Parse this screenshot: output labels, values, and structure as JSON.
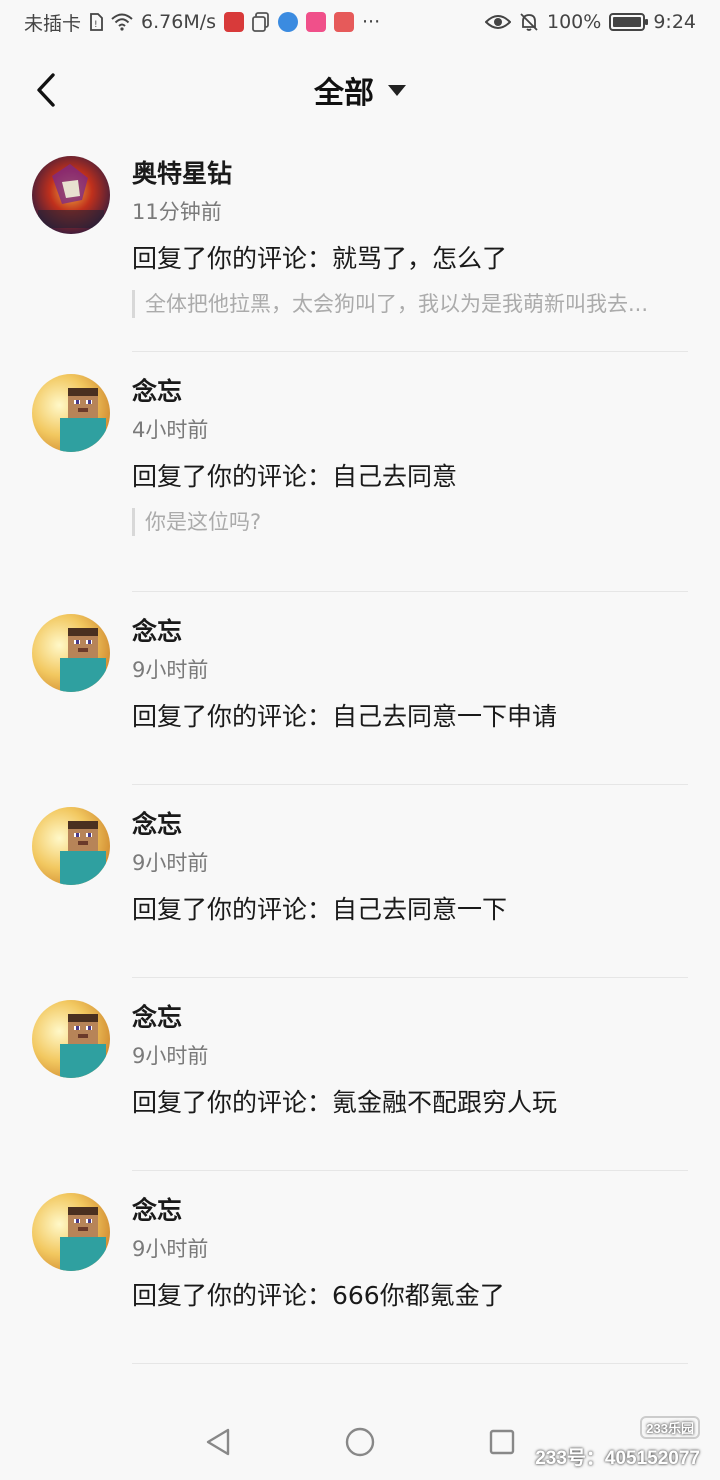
{
  "status_bar": {
    "carrier": "未插卡",
    "speed": "6.76M/s",
    "more": "···",
    "battery": "100%",
    "time": "9:24",
    "app_badge_colors": [
      "#d83a3a",
      "#3b8be0",
      "#f0508a",
      "#e65a5a"
    ]
  },
  "header": {
    "title": "全部"
  },
  "notifications": [
    {
      "name": "奥特星钻",
      "time": "11分钟前",
      "reply": "回复了你的评论：就骂了，怎么了",
      "quote": "全体把他拉黑，太会狗叫了，我以为是我萌新叫我去..."
    },
    {
      "name": "念忘",
      "time": "4小时前",
      "reply": "回复了你的评论：自己去同意",
      "quote": "你是这位吗?"
    },
    {
      "name": "念忘",
      "time": "9小时前",
      "reply": "回复了你的评论：自己去同意一下申请"
    },
    {
      "name": "念忘",
      "time": "9小时前",
      "reply": "回复了你的评论：自己去同意一下"
    },
    {
      "name": "念忘",
      "time": "9小时前",
      "reply": "回复了你的评论：氪金融不配跟穷人玩"
    },
    {
      "name": "念忘",
      "time": "9小时前",
      "reply": "回复了你的评论：666你都氪金了"
    }
  ],
  "watermark": {
    "logo": "233乐园",
    "text": "233号：405152077"
  },
  "colors": {
    "background": "#f8f8f8",
    "divider": "#e6e6e6",
    "secondary_text": "#7a7a7a",
    "quote_text": "#ababab"
  }
}
